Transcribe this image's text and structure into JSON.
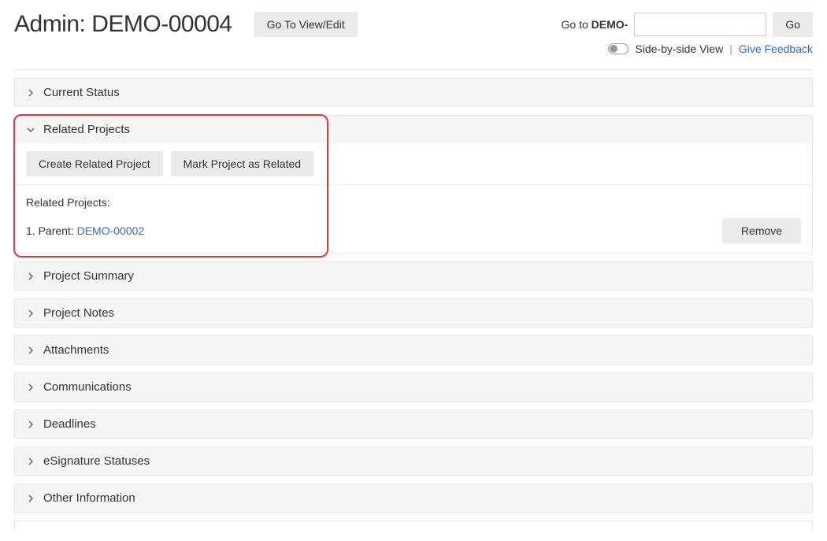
{
  "header": {
    "title": "Admin: DEMO-00004",
    "view_edit_label": "Go To View/Edit",
    "goto_prefix": "Go to ",
    "goto_bold": "DEMO-",
    "go_label": "Go"
  },
  "subheader": {
    "sbs_label": "Side-by-side View",
    "divider": "|",
    "feedback_label": "Give Feedback"
  },
  "panels": {
    "current_status": "Current Status",
    "related_projects": {
      "title": "Related Projects",
      "create_label": "Create Related Project",
      "mark_label": "Mark Project as Related",
      "list_heading": "Related Projects:",
      "item_prefix": "1. Parent: ",
      "item_link": "DEMO-00002",
      "remove_label": "Remove"
    },
    "project_summary": "Project Summary",
    "project_notes": "Project Notes",
    "attachments": "Attachments",
    "communications": "Communications",
    "deadlines": "Deadlines",
    "esignature": "eSignature Statuses",
    "other_info": "Other Information"
  }
}
